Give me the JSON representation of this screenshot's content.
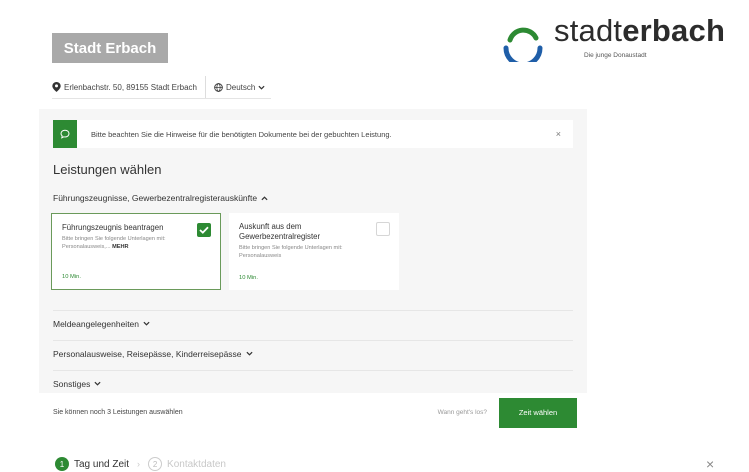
{
  "header": {
    "brand": "Stadt Erbach",
    "logo_light": "stadt",
    "logo_bold": "erbach",
    "logo_tagline": "Die junge Donaustadt",
    "address": "Erlenbachstr. 50, 89155 Stadt Erbach",
    "language": "Deutsch"
  },
  "notice": {
    "text": "Bitte beachten Sie die Hinweise für die benötigten Dokumente bei der gebuchten Leistung.",
    "close": "×"
  },
  "main": {
    "title": "Leistungen wählen",
    "open_category": "Führungszeugnisse, Gewerbezentralregisterauskünfte",
    "cards": [
      {
        "title": "Führungszeugnis beantragen",
        "desc": "Bitte bringen Sie folgende Unterlagen mit: Personalausweis,...",
        "more": "MEHR",
        "time": "10 Min.",
        "selected": true
      },
      {
        "title": "Auskunft aus dem Gewerbezentralregister",
        "desc": "Bitte bringen Sie folgende Unterlagen mit: Personalausweis",
        "more": "",
        "time": "10 Min.",
        "selected": false
      }
    ],
    "categories": [
      "Meldeangelegenheiten",
      "Personalausweise, Reisepässe, Kinderreisepässe",
      "Sonstiges"
    ]
  },
  "footer": {
    "remaining": "Sie können noch 3 Leistungen auswählen",
    "question": "Wann geht's los?",
    "button": "Zeit wählen"
  },
  "steps": [
    {
      "num": "1",
      "label": "Tag und Zeit",
      "active": true
    },
    {
      "num": "2",
      "label": "Kontaktdaten",
      "active": false
    }
  ],
  "close": "×",
  "colors": {
    "accent": "#2d8a33",
    "brand_box": "#a9a9a9",
    "logo_blue": "#1f5ea8"
  }
}
